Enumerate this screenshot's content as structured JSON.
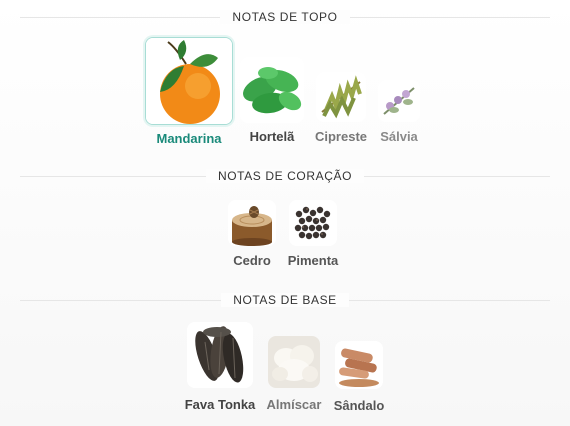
{
  "sections": [
    {
      "title": "NOTAS DE TOPO",
      "notes": [
        {
          "name": "Mandarina",
          "selected": true,
          "icon": "mandarin-icon"
        },
        {
          "name": "Hortelã",
          "selected": false,
          "icon": "mint-icon"
        },
        {
          "name": "Cipreste",
          "selected": false,
          "icon": "cypress-icon"
        },
        {
          "name": "Sálvia",
          "selected": false,
          "icon": "sage-icon"
        }
      ]
    },
    {
      "title": "NOTAS DE CORAÇÃO",
      "notes": [
        {
          "name": "Cedro",
          "selected": false,
          "icon": "cedar-icon"
        },
        {
          "name": "Pimenta",
          "selected": false,
          "icon": "pepper-icon"
        }
      ]
    },
    {
      "title": "NOTAS DE BASE",
      "notes": [
        {
          "name": "Fava Tonka",
          "selected": false,
          "icon": "tonka-bean-icon"
        },
        {
          "name": "Almíscar",
          "selected": false,
          "icon": "musk-icon"
        },
        {
          "name": "Sândalo",
          "selected": false,
          "icon": "sandalwood-icon"
        }
      ]
    }
  ],
  "colors": {
    "accent": "#1a8a7a",
    "selected_border": "#a8ddd5",
    "divider": "#e6e6e6"
  }
}
